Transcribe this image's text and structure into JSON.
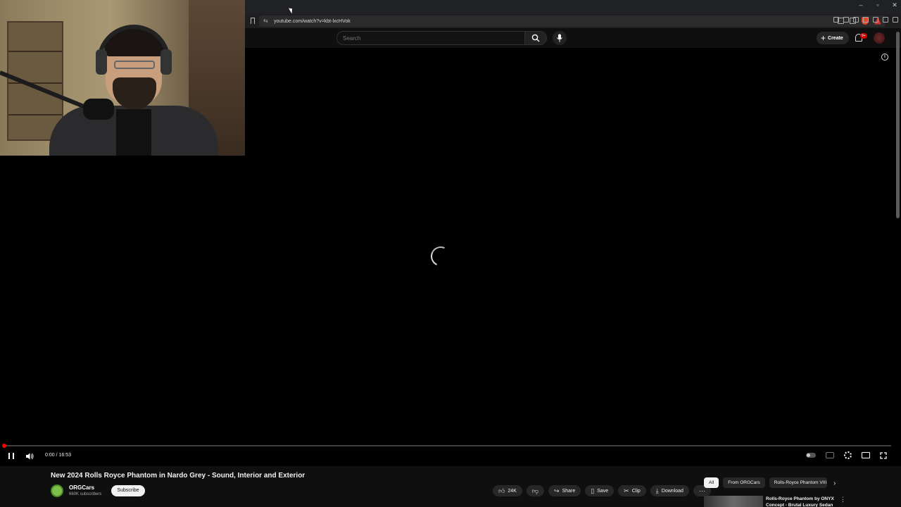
{
  "browser": {
    "url": "youtube.com/watch?v=kbt-lxcHVok",
    "window_controls": [
      "–",
      "▫",
      "✕"
    ]
  },
  "youtube_header": {
    "search_placeholder": "Search",
    "create_label": "Create",
    "notification_count": "9+"
  },
  "player": {
    "time_display": "0:00 / 16:53",
    "progress_fraction": 0.0,
    "state": "loading",
    "accent_color": "#ff0000"
  },
  "video": {
    "title": "New 2024 Rolls Royce Phantom in Nardo Grey - Sound, Interior and Exterior",
    "channel_name": "ORGCars",
    "channel_subscribers": "660K subscribers",
    "subscribe_label": "Subscribe",
    "like_count": "24K",
    "share_label": "Share",
    "save_label": "Save",
    "clip_label": "Clip",
    "download_label": "Download"
  },
  "related_chips": [
    "All",
    "From ORGCars",
    "Rolls-Royce Phantom VIII"
  ],
  "recommended": {
    "title": "Rolls-Royce Phantom by ONYX Concept - Brutal Luxury Sedan"
  }
}
